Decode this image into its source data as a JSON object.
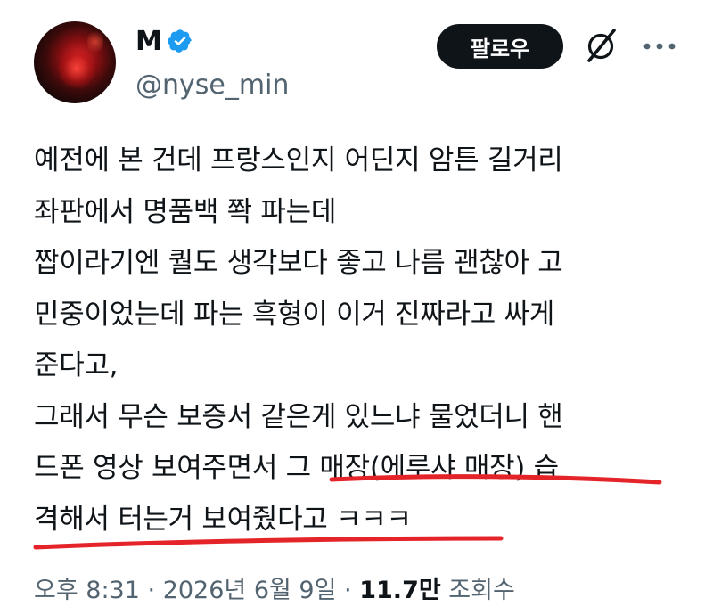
{
  "author": {
    "name": "M",
    "handle": "@nyse_min",
    "verified": true,
    "verified_color": "#1d9bf0"
  },
  "actions": {
    "follow_label": "팔로우",
    "grok_icon": "grok-slash-icon",
    "more_icon": "more-dots-icon"
  },
  "tweet": {
    "lines": [
      "예전에 본 건데 프랑스인지 어딘지 암튼 길거리",
      "좌판에서 명품백 쫙 파는데",
      "짭이라기엔 퀄도 생각보다 좋고 나름 괜찮아 고",
      "민중이었는데 파는 흑형이 이거 진짜라고 싸게",
      "준다고,",
      "그래서 무슨 보증서 같은게 있느냐 물었더니 핸",
      "드폰 영상 보여주면서 그 매장(에루샤 매장) 습",
      "격해서 터는거 보여줬다고 ㅋㅋㅋ"
    ],
    "annotation_color": "#e5242a"
  },
  "meta": {
    "time": "오후 8:31",
    "separator": "·",
    "date": "2026년 6월 9일",
    "views_count": "11.7만",
    "views_label": "조회수"
  }
}
